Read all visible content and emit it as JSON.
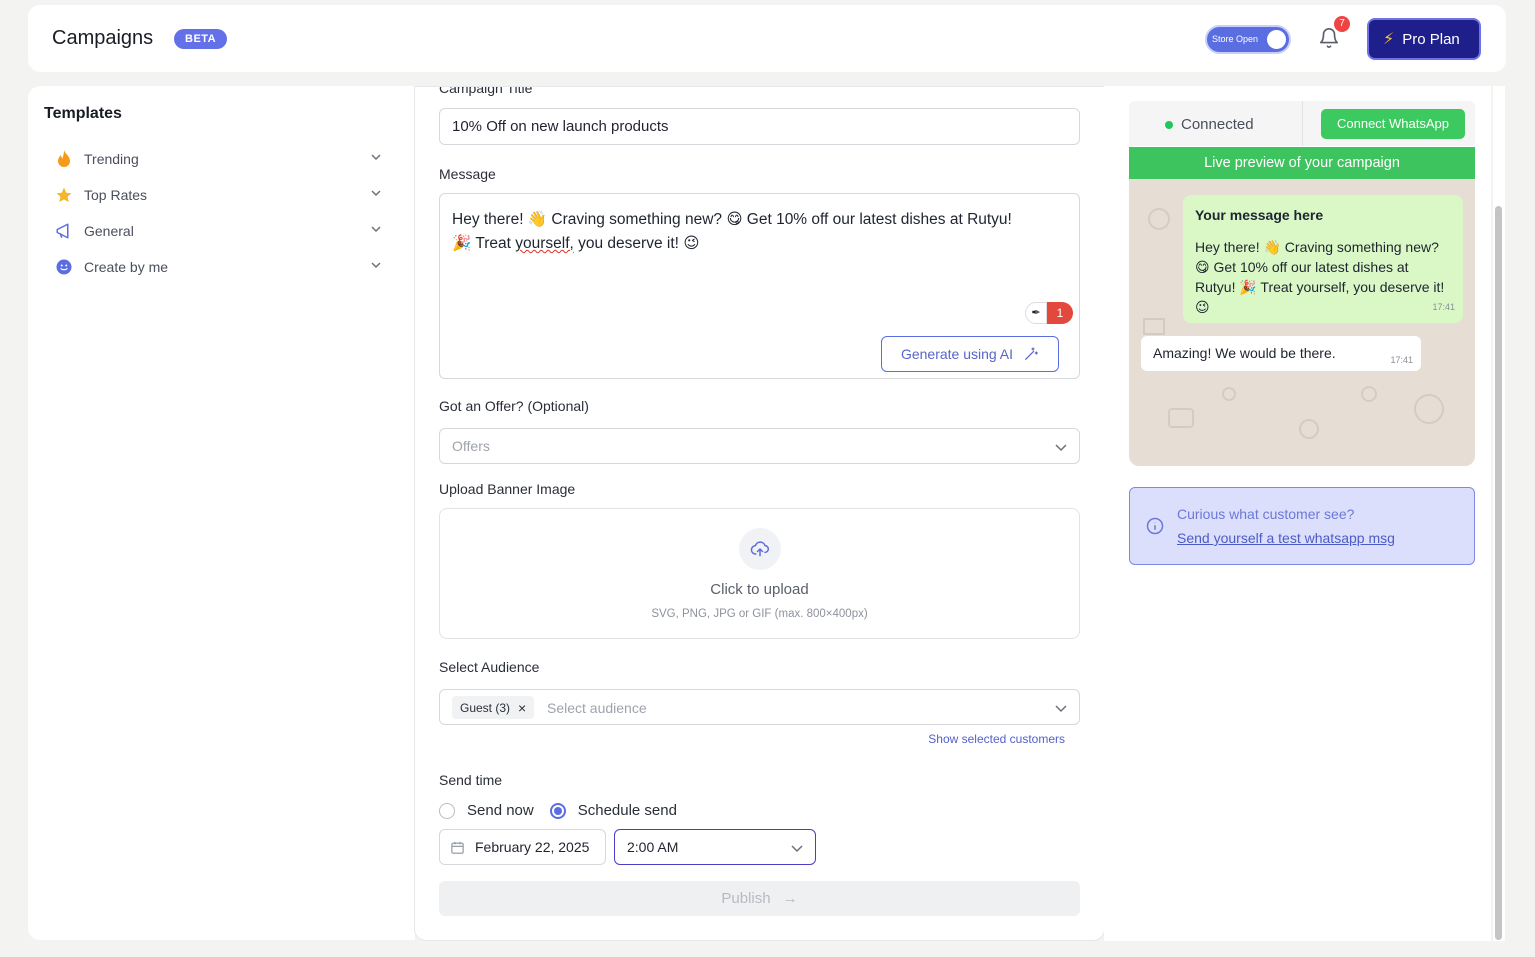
{
  "header": {
    "title": "Campaigns",
    "badge": "BETA",
    "store_toggle_label": "Store Open",
    "notification_count": "7",
    "pro_button": "Pro Plan"
  },
  "sidebar": {
    "title": "Templates",
    "items": [
      {
        "label": "Trending",
        "icon": "fire-icon"
      },
      {
        "label": "Top Rates",
        "icon": "star-icon"
      },
      {
        "label": "General",
        "icon": "megaphone-icon"
      },
      {
        "label": "Create by me",
        "icon": "smiley-icon"
      }
    ]
  },
  "form": {
    "campaign_title_label": "Campaign Title",
    "campaign_title_value": "10% Off on new launch products",
    "message_label": "Message",
    "message_part1": "Hey there! 👋  Craving something new? 😋  Get 10% off our latest dishes at Rutyu!",
    "message_part2": "🎉  Treat ",
    "message_misspelled": "yourself,",
    "message_part3": " you deserve it! 😉",
    "grammar_count": "1",
    "ai_button": "Generate using AI",
    "offer_label": "Got an Offer? (Optional)",
    "offer_placeholder": "Offers",
    "upload_label": "Upload Banner Image",
    "upload_title": "Click to upload",
    "upload_sub": "SVG, PNG, JPG or GIF (max. 800×400px)",
    "audience_label": "Select Audience",
    "audience_chip": "Guest (3)",
    "audience_placeholder": "Select audience",
    "show_selected": "Show selected customers",
    "send_time_label": "Send time",
    "send_now": "Send now",
    "schedule_send": "Schedule send",
    "selected_send_option": "Schedule send",
    "date_value": "February 22, 2025",
    "time_value": "2:00 AM",
    "publish_button": "Publish"
  },
  "preview": {
    "status": "Connected",
    "connect_button": "Connect WhatsApp",
    "strip": "Live preview of your campaign",
    "bubble_title": "Your message here",
    "bubble_text": "Hey there! 👋 Craving something new? 😋 Get 10% off our latest dishes at Rutyu! 🎉 Treat yourself, you deserve it! 😉",
    "bubble_time": "17:41",
    "reply_text": "Amazing! We would be there.",
    "reply_time": "17:41",
    "info_question": "Curious what customer see?",
    "info_link": "Send yourself a test whatsapp msg"
  },
  "colors": {
    "accent": "#5b6ee1",
    "whatsapp_green": "#3ec45f",
    "pro_bg": "#1e1f8a"
  }
}
